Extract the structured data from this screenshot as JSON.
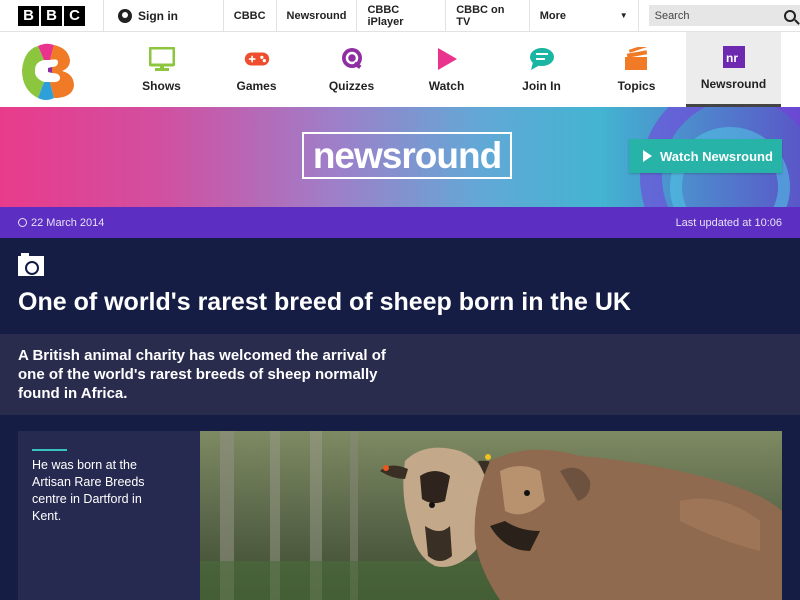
{
  "bbc_bar": {
    "logo_letters": [
      "B",
      "B",
      "C"
    ],
    "signin_label": "Sign in",
    "links": [
      "CBBC",
      "Newsround",
      "CBBC iPlayer",
      "CBBC on TV"
    ],
    "more_label": "More",
    "search_placeholder": "Search"
  },
  "nav": {
    "items": [
      {
        "label": "Shows",
        "icon": "tv-icon",
        "color": "#8cc63f"
      },
      {
        "label": "Games",
        "icon": "gamepad-icon",
        "color": "#ee4e2e"
      },
      {
        "label": "Quizzes",
        "icon": "quiz-icon",
        "color": "#8e2ea0"
      },
      {
        "label": "Watch",
        "icon": "play-icon",
        "color": "#e9338d"
      },
      {
        "label": "Join In",
        "icon": "chat-icon",
        "color": "#1bb5a3"
      },
      {
        "label": "Topics",
        "icon": "topics-icon",
        "color": "#f07a26"
      },
      {
        "label": "Newsround",
        "icon": "newsround-icon",
        "color": "#6d2ab0"
      }
    ],
    "active": "Newsround"
  },
  "banner": {
    "logo_text": "newsround",
    "watch_label": "Watch Newsround"
  },
  "article": {
    "date": "22 March 2014",
    "last_updated": "Last updated at 10:06",
    "headline": "One of world's rarest breed of sheep born in the UK",
    "summary": "A British animal charity has welcomed the arrival of one of the world's rarest breeds of sheep normally found in Africa.",
    "caption": "He was born at the Artisan Rare Breeds centre in Dartford in Kent."
  },
  "colors": {
    "date_bar": "#5c2ec2",
    "headline_bg": "#151d45",
    "summary_bg": "#2a2c4e",
    "watch_button": "#27b3a8",
    "caption_rule": "#37c4c0"
  }
}
